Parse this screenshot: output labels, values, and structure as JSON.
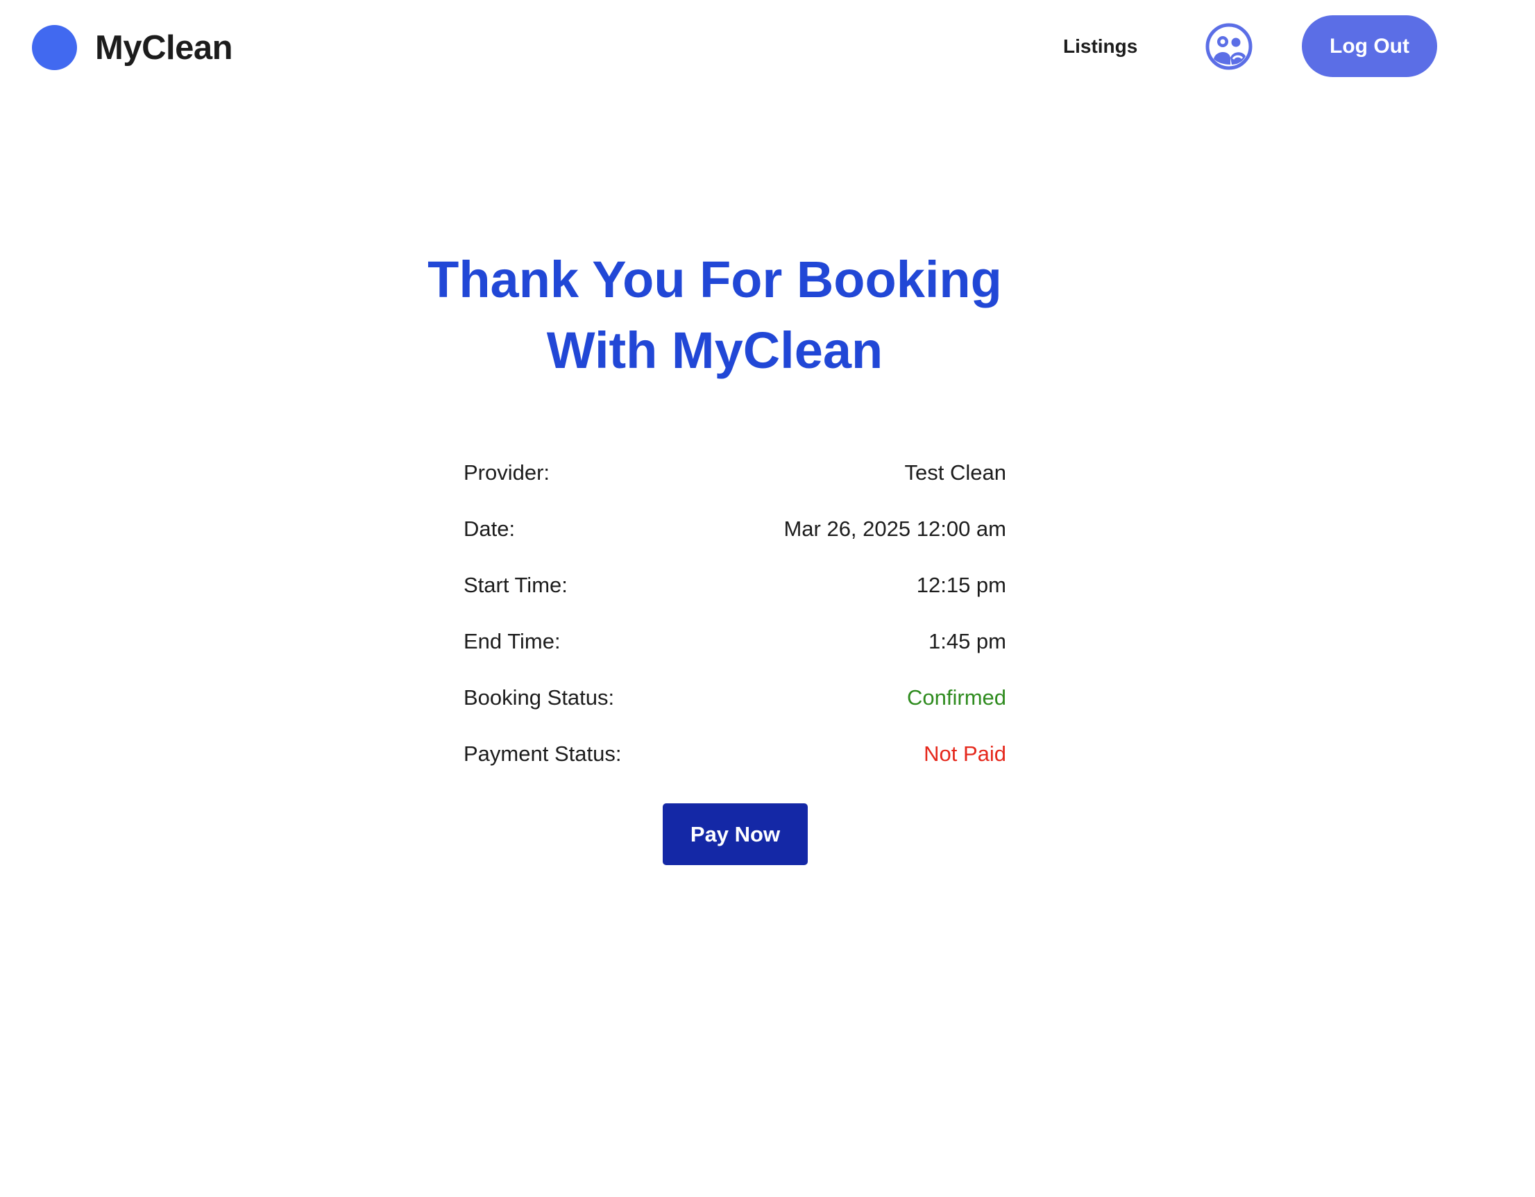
{
  "header": {
    "brand_name": "MyClean",
    "brand_color": "#4169f0",
    "nav": {
      "listings_label": "Listings"
    },
    "avatar_icon": "user-avatar-icon",
    "logout_label": "Log Out",
    "logout_color": "#5b6ee6"
  },
  "main": {
    "title_line1": "Thank You For Booking",
    "title_line2": "With MyClean",
    "title_color": "#2147d6",
    "details": [
      {
        "label": "Provider:",
        "value": "Test Clean"
      },
      {
        "label": "Date:",
        "value": "Mar 26, 2025 12:00 am"
      },
      {
        "label": "Start Time:",
        "value": "12:15 pm"
      },
      {
        "label": "End Time:",
        "value": "1:45 pm"
      },
      {
        "label": "Booking Status:",
        "value": "Confirmed",
        "color": "#2e8b1e"
      },
      {
        "label": "Payment Status:",
        "value": "Not Paid",
        "color": "#e5281c"
      }
    ],
    "pay_button_label": "Pay Now",
    "pay_button_color": "#1428a6"
  }
}
